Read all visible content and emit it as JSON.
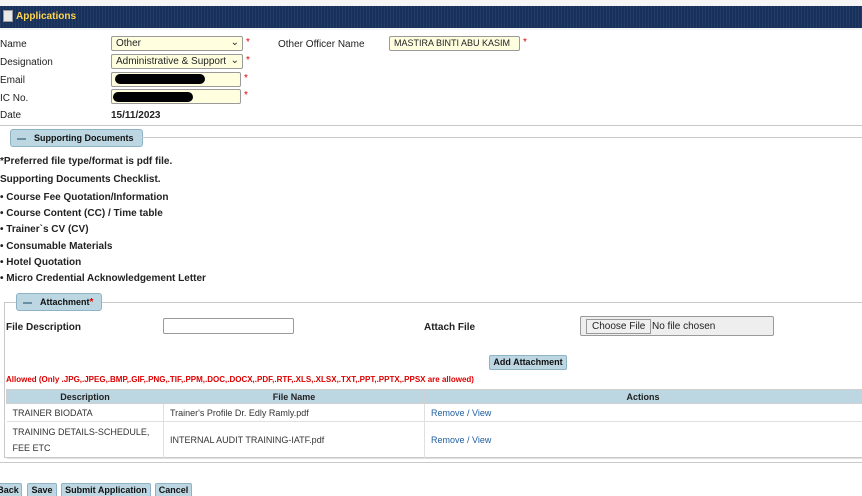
{
  "app": {
    "title": "Applications"
  },
  "form": {
    "name_label": "Name",
    "name_value": "Other",
    "designation_label": "Designation",
    "designation_value": "Administrative & Support",
    "email_label": "Email",
    "ic_label": "IC No.",
    "date_label": "Date",
    "date_value": "15/11/2023",
    "other_officer_label": "Other Officer Name",
    "other_officer_value": "MASTIRA BINTI ABU KASIM",
    "required_mark": "*"
  },
  "supporting": {
    "section_title": "Supporting Documents",
    "note": "*Preferred file type/format is pdf file.",
    "checklist_title": "Supporting Documents Checklist.",
    "items": [
      "• Course Fee Quotation/Information",
      "• Course Content (CC) / Time table",
      "• Trainer`s CV (CV)",
      "• Consumable Materials",
      "• Hotel Quotation",
      "• Micro Credential Acknowledgement Letter"
    ]
  },
  "attachment": {
    "section_title": "Attachment",
    "file_description_label": "File Description",
    "attach_file_label": "Attach File",
    "choose_file_label": "Choose File",
    "no_file_text": "No file chosen",
    "add_button": "Add Attachment",
    "allowed_text": "Allowed (Only .JPG,.JPEG,.BMP,.GIF,.PNG,.TIF,.PPM,.DOC,.DOCX,.PDF,.RTF,.XLS,.XLSX,.TXT,.PPT,.PPTX,.PPSX are allowed)",
    "columns": [
      "Description",
      "File Name",
      "Actions"
    ],
    "rows": [
      {
        "description": "TRAINER BIODATA",
        "file_name": "Trainer's Profile Dr. Edly Ramly.pdf",
        "remove": "Remove",
        "sep": " / ",
        "view": "View"
      },
      {
        "description": "TRAINING DETAILS-SCHEDULE, FEE ETC",
        "file_name": "INTERNAL AUDIT TRAINING-IATF.pdf",
        "remove": "Remove",
        "sep": " / ",
        "view": "View"
      }
    ]
  },
  "footer": {
    "back": "Back",
    "save": "Save",
    "submit": "Submit Application",
    "cancel": "Cancel"
  },
  "colors": {
    "title_bar": "#18315c",
    "title_text": "#ffd54a",
    "input_bg": "#ffffe0",
    "button_bg": "#bcd6e2",
    "required": "#dd0000",
    "link": "#1f5fa0"
  }
}
